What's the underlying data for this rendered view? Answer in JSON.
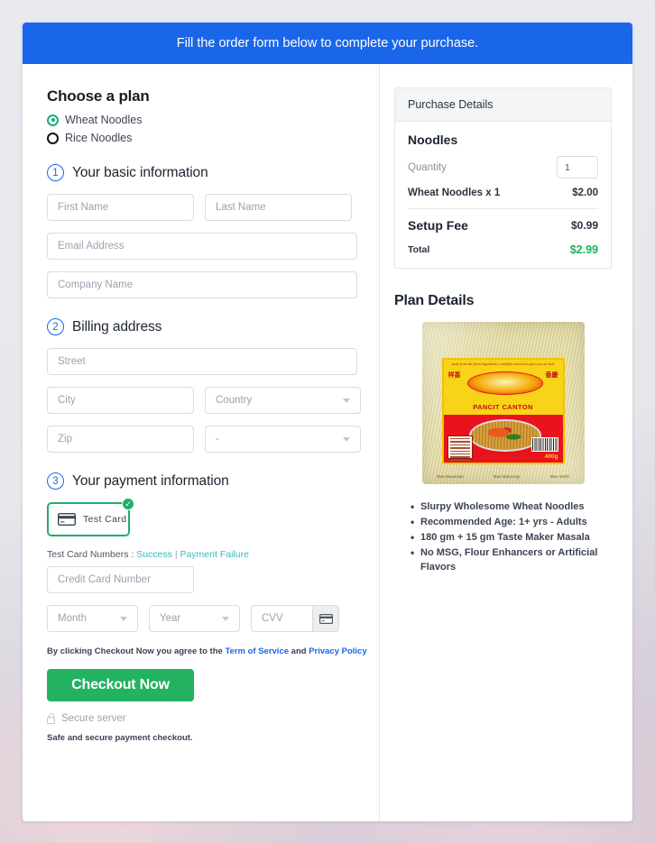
{
  "banner": {
    "text": "Fill the order form below to complete your purchase."
  },
  "plan": {
    "heading": "Choose a plan",
    "options": [
      {
        "label": "Wheat Noodles",
        "selected": true
      },
      {
        "label": "Rice Noodles",
        "selected": false
      }
    ]
  },
  "steps": {
    "basic": {
      "number": "1",
      "title": "Your basic information"
    },
    "billing": {
      "number": "2",
      "title": "Billing address"
    },
    "payment": {
      "number": "3",
      "title": "Your payment information"
    }
  },
  "fields": {
    "first_name": {
      "placeholder": "First Name",
      "value": ""
    },
    "last_name": {
      "placeholder": "Last Name",
      "value": ""
    },
    "email": {
      "placeholder": "Email Address",
      "value": ""
    },
    "company": {
      "placeholder": "Company Name",
      "value": ""
    },
    "street": {
      "placeholder": "Street",
      "value": ""
    },
    "city": {
      "placeholder": "City",
      "value": ""
    },
    "country": {
      "placeholder": "Country",
      "value": ""
    },
    "zip": {
      "placeholder": "Zip",
      "value": ""
    },
    "state": {
      "placeholder": "-",
      "value": ""
    },
    "card_number": {
      "placeholder": "Credit Card Number",
      "value": ""
    },
    "month": {
      "placeholder": "Month",
      "value": ""
    },
    "year": {
      "placeholder": "Year",
      "value": ""
    },
    "cvv": {
      "placeholder": "CVV",
      "value": ""
    }
  },
  "payment": {
    "test_card_label": "Test Card",
    "test_numbers_prefix": "Test Card Numbers :",
    "link_success": "Success",
    "link_separator": "|",
    "link_failure": "Payment Failure"
  },
  "agreement": {
    "prefix": "By clicking Checkout Now you agree to the",
    "terms": "Term of Service",
    "conjunction": "and",
    "privacy": "Privacy Policy"
  },
  "checkout": {
    "button_label": "Checkout Now",
    "secure_label": "Secure server",
    "safe_note": "Safe and secure payment checkout."
  },
  "purchase_details": {
    "header": "Purchase Details",
    "product_title": "Noodles",
    "quantity_label": "Quantity",
    "quantity_value": "1",
    "line_item_label": "Wheat Noodles x 1",
    "line_item_price": "$2.00",
    "setup_fee_label": "Setup Fee",
    "setup_fee_price": "$0.99",
    "total_label": "Total",
    "total_price": "$2.99"
  },
  "plan_details": {
    "heading": "Plan Details",
    "product_image": {
      "tagline": "made from the finest ingredients, carefully selected to give you our best",
      "brand_sub": "PANCIT CANTON",
      "cjk_left": "祥喜",
      "cjk_right": "香慶",
      "weight": "400g",
      "footer": [
        "Mas Masarap!",
        "Mas Malusog!",
        "Mas Sulit!"
      ]
    },
    "bullets": [
      "Slurpy Wholesome Wheat Noodles",
      "Recommended Age: 1+ yrs - Adults",
      "180 gm + 15 gm Taste Maker Masala",
      "No MSG, Flour Enhancers or Artificial Flavors"
    ]
  },
  "colors": {
    "banner_blue": "#1a66ea",
    "accent_green": "#23b260",
    "total_green": "#14b45e",
    "link_blue": "#1a66ea",
    "link_teal": "#3bb6c9",
    "radio_selected": "#13b07c"
  }
}
